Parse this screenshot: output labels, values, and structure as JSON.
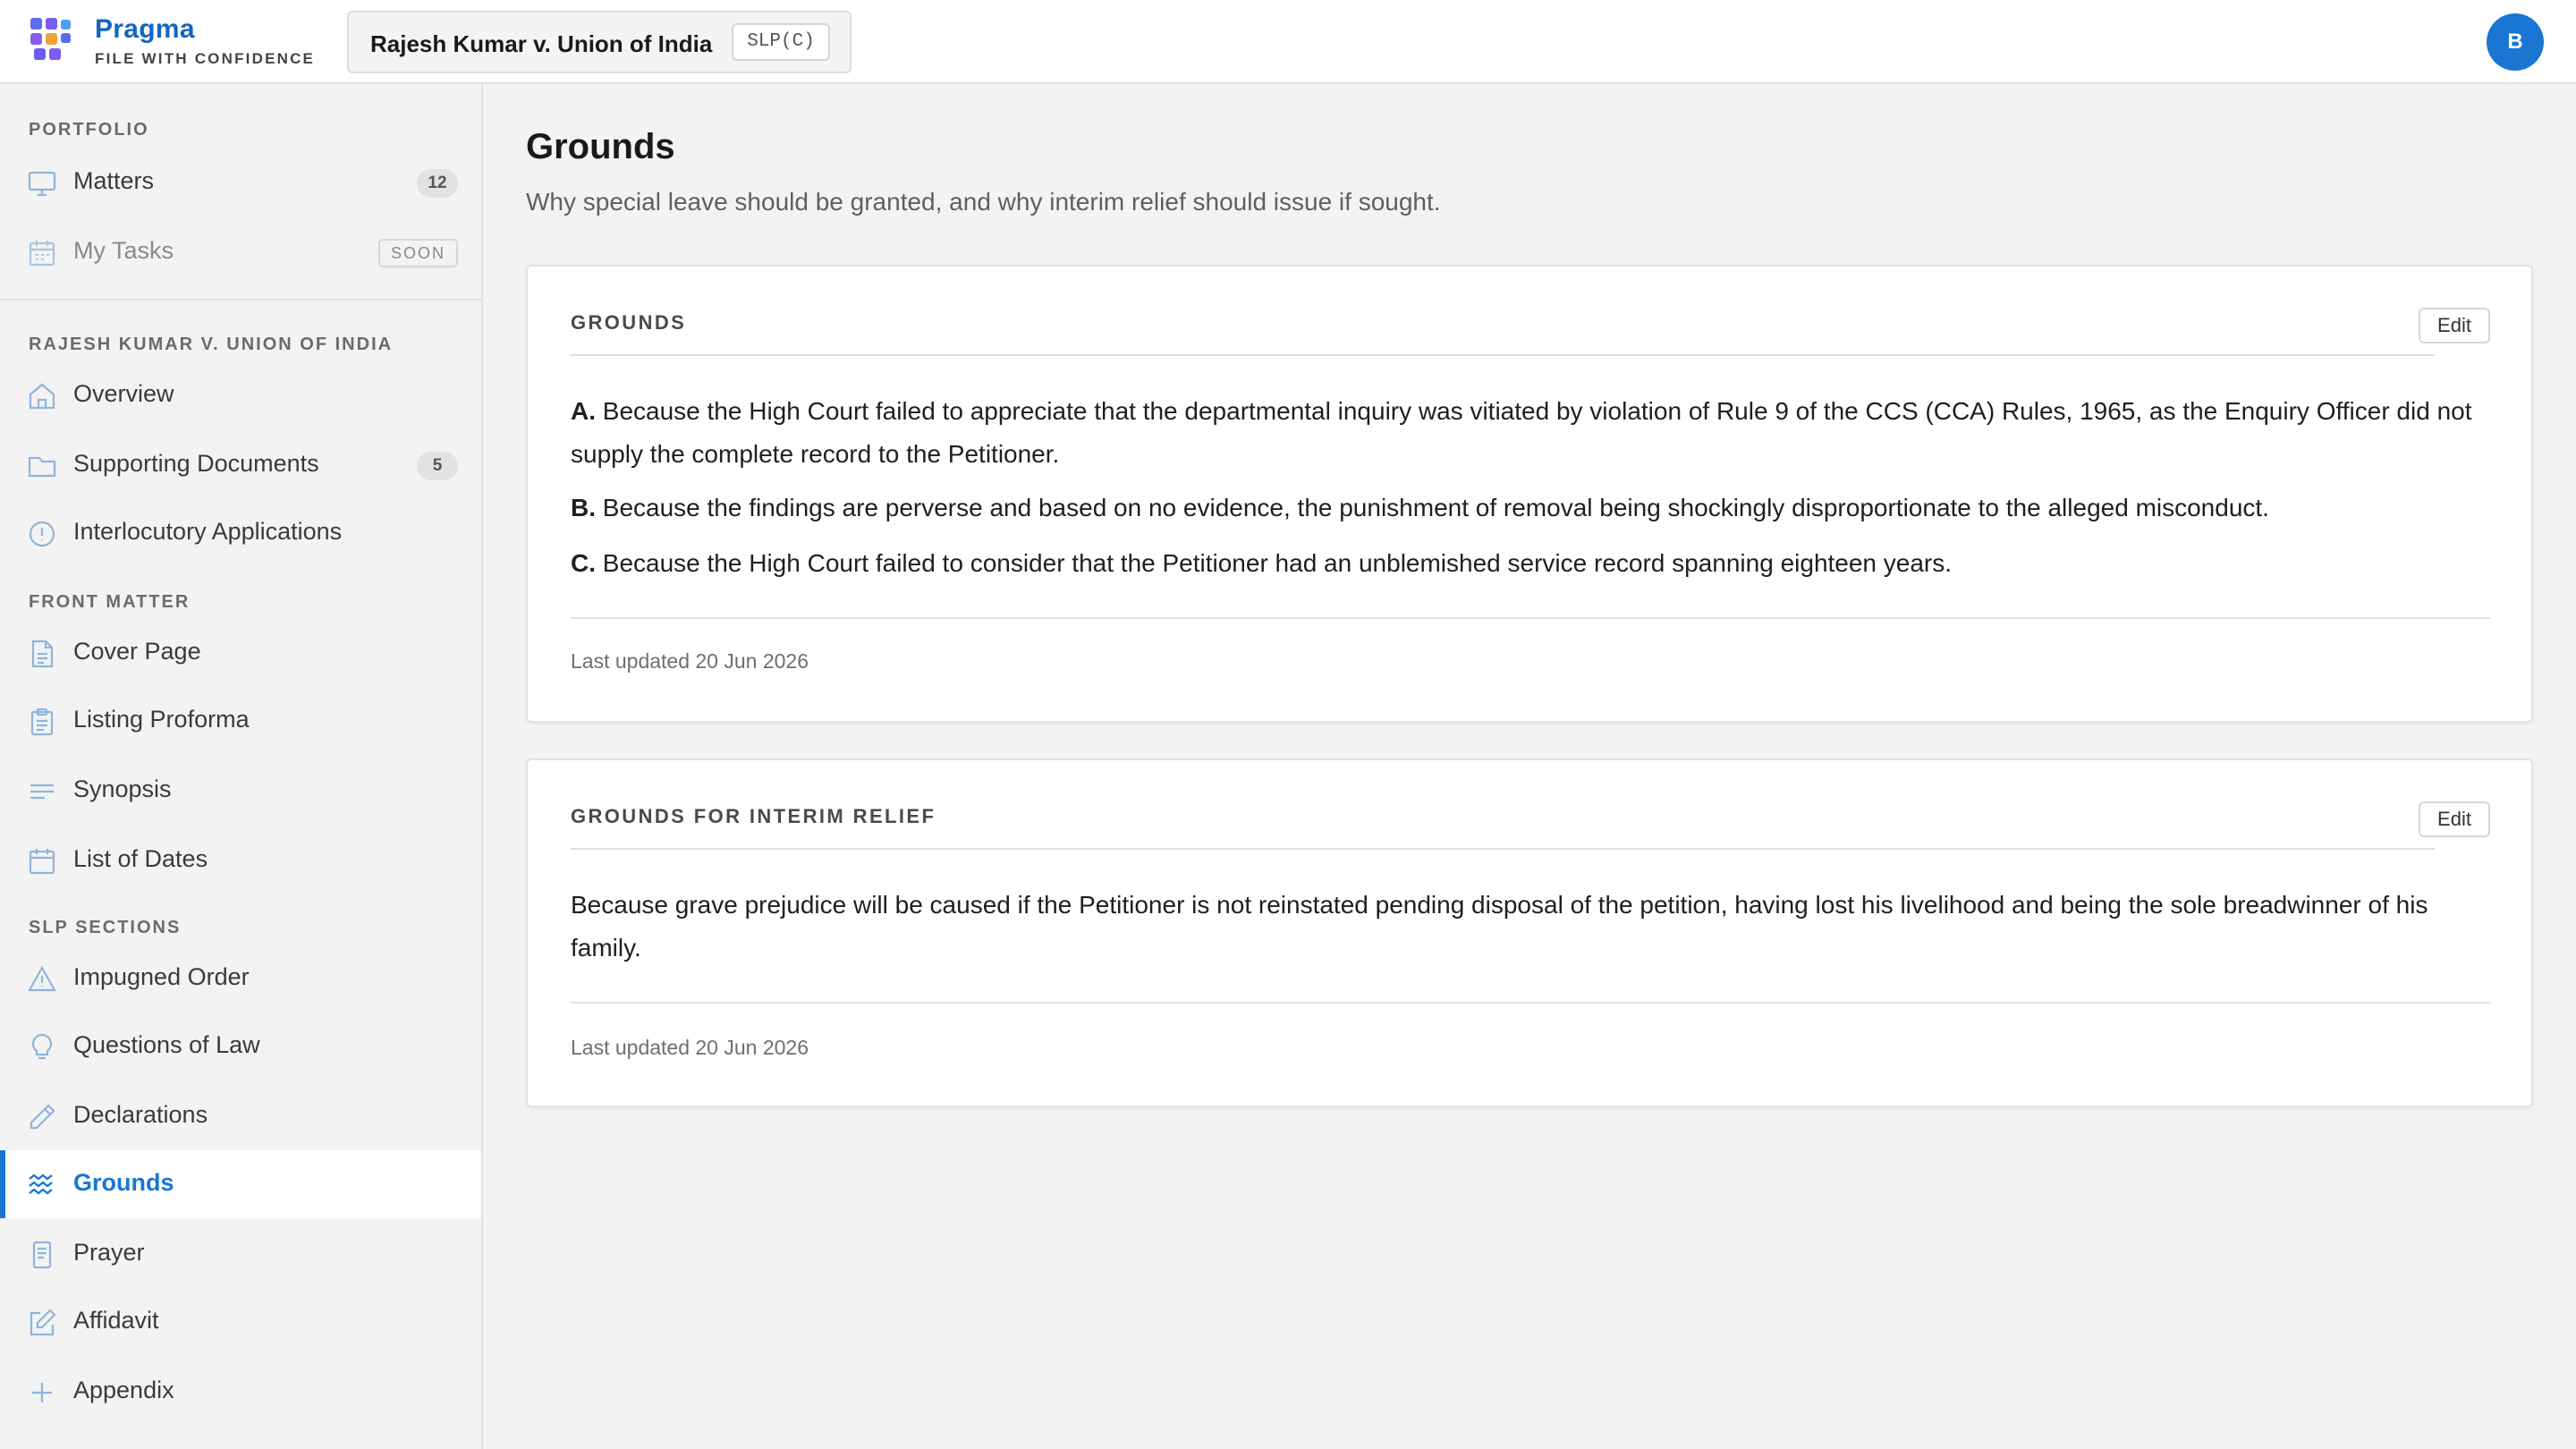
{
  "header": {
    "brand_name": "Pragma",
    "brand_tagline": "FILE WITH CONFIDENCE",
    "matter_title": "Rajesh Kumar v. Union of India",
    "matter_type": "SLP(C)",
    "avatar_initial": "B"
  },
  "sidebar": {
    "portfolio_label": "PORTFOLIO",
    "portfolio_items": [
      {
        "label": "Matters",
        "badge": "12",
        "icon": "monitor-icon"
      },
      {
        "label": "My Tasks",
        "badge": "SOON",
        "icon": "calendar-icon"
      }
    ],
    "matter_label": "RAJESH KUMAR V. UNION OF INDIA",
    "matter_items": [
      {
        "label": "Overview",
        "icon": "home-icon"
      },
      {
        "label": "Supporting Documents",
        "badge": "5",
        "icon": "folder-icon"
      },
      {
        "label": "Interlocutory Applications",
        "icon": "alert-circle-icon"
      }
    ],
    "front_label": "FRONT MATTER",
    "front_items": [
      {
        "label": "Cover Page",
        "icon": "document-icon"
      },
      {
        "label": "Listing Proforma",
        "icon": "clipboard-icon"
      },
      {
        "label": "Synopsis",
        "icon": "lines-icon"
      },
      {
        "label": "List of Dates",
        "icon": "calendar-icon"
      }
    ],
    "slp_label": "SLP SECTIONS",
    "slp_items": [
      {
        "label": "Impugned Order",
        "icon": "warning-triangle-icon"
      },
      {
        "label": "Questions of Law",
        "icon": "lightbulb-icon"
      },
      {
        "label": "Declarations",
        "icon": "pencil-icon"
      },
      {
        "label": "Grounds",
        "icon": "waves-icon",
        "active": true
      },
      {
        "label": "Prayer",
        "icon": "receipt-icon"
      },
      {
        "label": "Affidavit",
        "icon": "edit-square-icon"
      },
      {
        "label": "Appendix",
        "icon": "plus-icon"
      }
    ]
  },
  "main": {
    "title": "Grounds",
    "subtitle": "Why special leave should be granted, and why interim relief should issue if sought.",
    "grounds_card": {
      "title": "GROUNDS",
      "edit_label": "Edit",
      "items": [
        {
          "letter": "A.",
          "text": "Because the High Court failed to appreciate that the departmental inquiry was vitiated by violation of Rule 9 of the CCS (CCA) Rules, 1965, as the Enquiry Officer did not supply the complete record to the Petitioner."
        },
        {
          "letter": "B.",
          "text": "Because the findings are perverse and based on no evidence, the punishment of removal being shockingly disproportionate to the alleged misconduct."
        },
        {
          "letter": "C.",
          "text": "Because the High Court failed to consider that the Petitioner had an unblemished service record spanning eighteen years."
        }
      ],
      "updated": "Last updated 20 Jun 2026"
    },
    "interim_card": {
      "title": "GROUNDS FOR INTERIM RELIEF",
      "edit_label": "Edit",
      "text": "Because grave prejudice will be caused if the Petitioner is not reinstated pending disposal of the petition, having lost his livelihood and being the sole breadwinner of his family.",
      "updated": "Last updated 20 Jun 2026"
    }
  },
  "colors": {
    "accent": "#1976d2",
    "brand": "#1565c0",
    "sidebar_icon": "#8fb4dd"
  }
}
